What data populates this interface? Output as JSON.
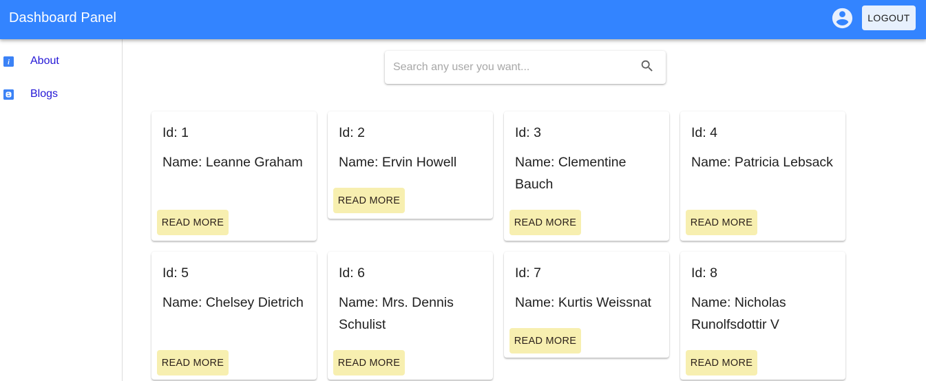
{
  "header": {
    "title": "Dashboard Panel",
    "account_icon": "account-circle-icon",
    "logout_label": "LOGOUT",
    "brand_color": "#3384ff"
  },
  "sidebar": {
    "items": [
      {
        "label": "About",
        "icon": "info-icon"
      },
      {
        "label": "Blogs",
        "icon": "blogger-icon"
      }
    ]
  },
  "search": {
    "placeholder": "Search any user you want...",
    "value": "",
    "icon": "search-icon"
  },
  "cards": [
    {
      "id": "Id: 1",
      "name": "Name: Leanne Graham",
      "button": "READ MORE"
    },
    {
      "id": "Id: 2",
      "name": "Name: Ervin Howell",
      "button": "READ MORE"
    },
    {
      "id": "Id: 3",
      "name": "Name: Clementine Bauch",
      "button": "READ MORE"
    },
    {
      "id": "Id: 4",
      "name": "Name: Patricia Lebsack",
      "button": "READ MORE"
    },
    {
      "id": "Id: 5",
      "name": "Name: Chelsey Dietrich",
      "button": "READ MORE"
    },
    {
      "id": "Id: 6",
      "name": "Name: Mrs. Dennis Schulist",
      "button": "READ MORE"
    },
    {
      "id": "Id: 7",
      "name": "Name: Kurtis Weissnat",
      "button": "READ MORE"
    },
    {
      "id": "Id: 8",
      "name": "Name: Nicholas Runolfsdottir V",
      "button": "READ MORE"
    }
  ],
  "colors": {
    "read_more_bg": "#f7efb0",
    "sidebar_link": "#2316d6",
    "logout_bg": "#e7f0fd"
  }
}
